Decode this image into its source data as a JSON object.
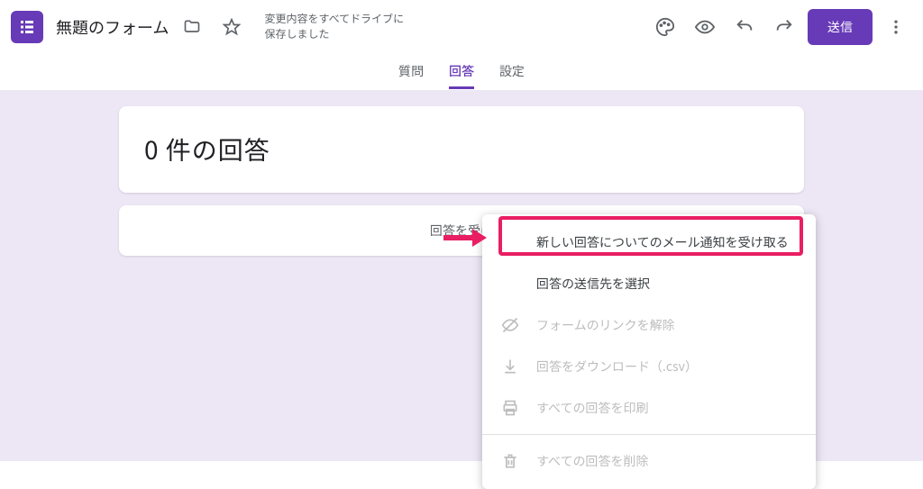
{
  "header": {
    "title": "無題のフォーム",
    "save_status": "変更内容をすべてドライブに保存しました",
    "send_label": "送信"
  },
  "tabs": {
    "questions": "質問",
    "responses": "回答",
    "settings": "設定"
  },
  "main": {
    "response_count_text": "0 件の回答",
    "accepting_label_partial": "回答を受け"
  },
  "menu": {
    "email_notify": "新しい回答についてのメール通知を受け取る",
    "select_destination": "回答の送信先を選択",
    "unlink_form": "フォームのリンクを解除",
    "download_csv": "回答をダウンロード（.csv）",
    "print_all": "すべての回答を印刷",
    "delete_all": "すべての回答を削除"
  }
}
